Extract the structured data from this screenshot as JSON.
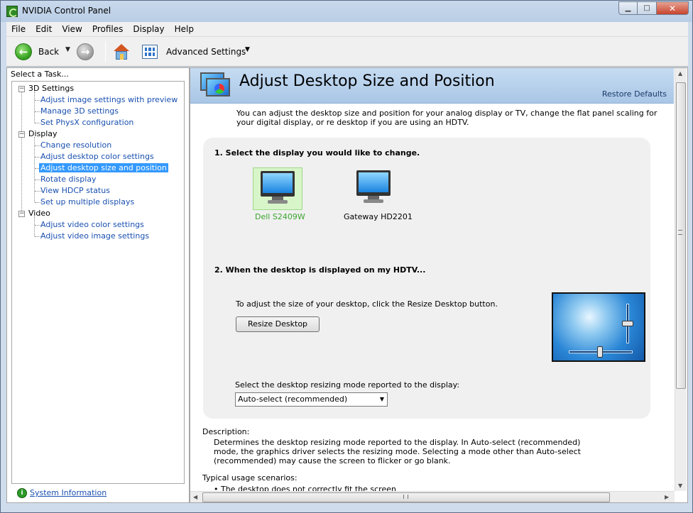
{
  "window": {
    "title": "NVIDIA Control Panel",
    "minimize": "▁",
    "maximize": "□",
    "close": "✕"
  },
  "menu": [
    "File",
    "Edit",
    "View",
    "Profiles",
    "Display",
    "Help"
  ],
  "toolbar": {
    "back_label": "Back",
    "advanced_label": "Advanced Settings",
    "dropdown_glyph": "▼",
    "back_glyph": "←",
    "forward_glyph": "→"
  },
  "sidebar": {
    "header": "Select a Task...",
    "categories": [
      {
        "label": "3D Settings",
        "toggle": "−",
        "items": [
          "Adjust image settings with preview",
          "Manage 3D settings",
          "Set PhysX configuration"
        ]
      },
      {
        "label": "Display",
        "toggle": "−",
        "items": [
          "Change resolution",
          "Adjust desktop color settings",
          "Adjust desktop size and position",
          "Rotate display",
          "View HDCP status",
          "Set up multiple displays"
        ]
      },
      {
        "label": "Video",
        "toggle": "−",
        "items": [
          "Adjust video color settings",
          "Adjust video image settings"
        ]
      }
    ],
    "selected_item": "Adjust desktop size and position",
    "system_info": "System Information"
  },
  "main": {
    "title": "Adjust Desktop Size and Position",
    "restore_defaults": "Restore Defaults",
    "intro": "You can adjust the desktop size and position for your analog display or TV, change the flat panel scaling for your digital display, or re desktop if you are using an HDTV.",
    "step1": "1. Select the display you would like to change.",
    "displays": [
      {
        "name": "Dell S2409W",
        "selected": true
      },
      {
        "name": "Gateway HD2201",
        "selected": false
      }
    ],
    "step2": "2. When the desktop is displayed on my HDTV...",
    "resize_text": "To adjust the size of your desktop, click the Resize Desktop button.",
    "resize_button": "Resize Desktop",
    "mode_label": "Select the desktop resizing mode reported to the display:",
    "mode_value": "Auto-select (recommended)",
    "description_head": "Description:",
    "description": "Determines the desktop resizing mode reported to the display. In Auto-select (recommended) mode, the graphics driver selects the resizing mode. Selecting a mode other than Auto-select (recommended) may cause the screen to flicker or go blank.",
    "typical_head": "Typical usage scenarios:",
    "typical_items": [
      "• The desktop does not correctly fit the screen"
    ]
  },
  "colors": {
    "selected_display": "#3aa52e",
    "link": "#1a50b0",
    "selection": "#3399ff"
  },
  "icons": [
    "back-arrow-icon",
    "forward-arrow-icon",
    "home-icon",
    "advanced-settings-icon",
    "system-information-icon",
    "nvidia-icon",
    "monitor-icon"
  ]
}
